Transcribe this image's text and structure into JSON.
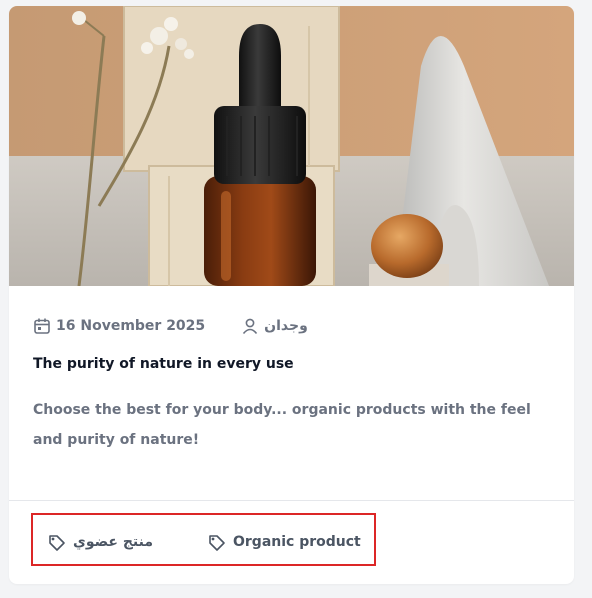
{
  "post": {
    "image_alt": "Amber dropper bottle with wooden blocks, dried flowers and an argan nut",
    "date": "16 November 2025",
    "author": "وجدان",
    "title": "The purity of nature in every use",
    "excerpt": "Choose the best for your body... organic products with the feel and purity of nature!"
  },
  "tags": [
    {
      "label": "منتج عضوي",
      "icon": "tag-icon"
    },
    {
      "label": "Organic product",
      "icon": "tag-icon"
    }
  ],
  "colors": {
    "highlight_border": "#dc2626",
    "meta_text": "#6b7280",
    "title_text": "#111827"
  }
}
